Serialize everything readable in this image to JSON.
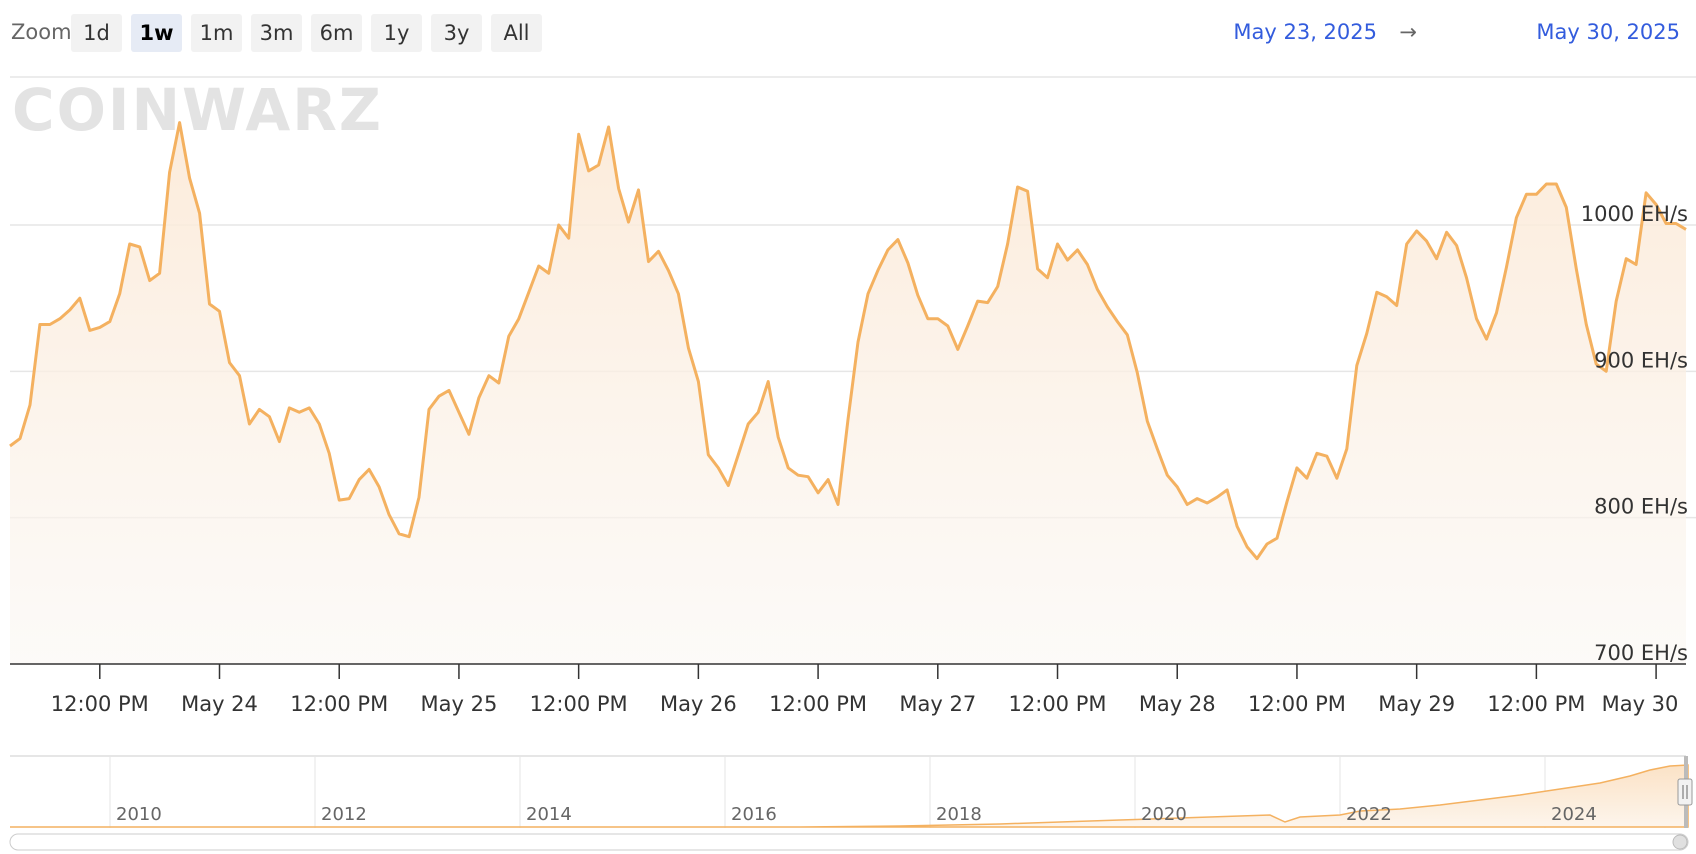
{
  "toolbar": {
    "zoom_label": "Zoom",
    "zoom_buttons": [
      {
        "label": "1d",
        "active": false
      },
      {
        "label": "1w",
        "active": true
      },
      {
        "label": "1m",
        "active": false
      },
      {
        "label": "3m",
        "active": false
      },
      {
        "label": "6m",
        "active": false
      },
      {
        "label": "1y",
        "active": false
      },
      {
        "label": "3y",
        "active": false
      },
      {
        "label": "All",
        "active": false
      }
    ],
    "range_start": "May 23, 2025",
    "range_arrow": "→",
    "range_end": "May 30, 2025"
  },
  "watermark": "COINWARZ",
  "colors": {
    "series_line": "#f4b160",
    "series_fill_top": "#fbe9d6",
    "grid": "#e6e6e6",
    "date_text": "#335cdd"
  },
  "chart_data": {
    "type": "area",
    "y_unit": "EH/s",
    "ylim": [
      700,
      1060
    ],
    "y_ticks": [
      {
        "value": 700,
        "label": "700 EH/s"
      },
      {
        "value": 800,
        "label": "800 EH/s"
      },
      {
        "value": 900,
        "label": "900 EH/s"
      },
      {
        "value": 1000,
        "label": "1000 EH/s"
      }
    ],
    "x_start": "2025-05-23 03:00",
    "x_end": "2025-05-30 04:00",
    "x_ticks": [
      {
        "at": "2025-05-23 12:00",
        "label": "12:00 PM"
      },
      {
        "at": "2025-05-24 00:00",
        "label": "May 24"
      },
      {
        "at": "2025-05-24 12:00",
        "label": "12:00 PM"
      },
      {
        "at": "2025-05-25 00:00",
        "label": "May 25"
      },
      {
        "at": "2025-05-25 12:00",
        "label": "12:00 PM"
      },
      {
        "at": "2025-05-26 00:00",
        "label": "May 26"
      },
      {
        "at": "2025-05-26 12:00",
        "label": "12:00 PM"
      },
      {
        "at": "2025-05-27 00:00",
        "label": "May 27"
      },
      {
        "at": "2025-05-27 12:00",
        "label": "12:00 PM"
      },
      {
        "at": "2025-05-28 00:00",
        "label": "May 28"
      },
      {
        "at": "2025-05-28 12:00",
        "label": "12:00 PM"
      },
      {
        "at": "2025-05-29 00:00",
        "label": "May 29"
      },
      {
        "at": "2025-05-29 12:00",
        "label": "12:00 PM"
      },
      {
        "at": "2025-05-30 00:00",
        "label": "May 30"
      }
    ],
    "series": [
      {
        "values": [
          [
            0,
            849
          ],
          [
            1,
            854
          ],
          [
            2,
            877
          ],
          [
            3,
            932
          ],
          [
            4,
            932
          ],
          [
            5,
            936
          ],
          [
            6,
            942
          ],
          [
            7,
            950
          ],
          [
            8,
            928
          ],
          [
            9,
            930
          ],
          [
            10,
            934
          ],
          [
            11,
            953
          ],
          [
            12,
            987
          ],
          [
            13,
            985
          ],
          [
            14,
            962
          ],
          [
            15,
            967
          ],
          [
            16,
            1036
          ],
          [
            17,
            1070
          ],
          [
            18,
            1032
          ],
          [
            19,
            1008
          ],
          [
            20,
            946
          ],
          [
            21,
            941
          ],
          [
            22,
            906
          ],
          [
            23,
            897
          ],
          [
            24,
            864
          ],
          [
            25,
            874
          ],
          [
            26,
            869
          ],
          [
            27,
            852
          ],
          [
            28,
            875
          ],
          [
            29,
            872
          ],
          [
            30,
            875
          ],
          [
            31,
            864
          ],
          [
            32,
            844
          ],
          [
            33,
            812
          ],
          [
            34,
            813
          ],
          [
            35,
            826
          ],
          [
            36,
            833
          ],
          [
            37,
            821
          ],
          [
            38,
            802
          ],
          [
            39,
            789
          ],
          [
            40,
            787
          ],
          [
            41,
            814
          ],
          [
            42,
            874
          ],
          [
            43,
            883
          ],
          [
            44,
            887
          ],
          [
            45,
            872
          ],
          [
            46,
            857
          ],
          [
            47,
            882
          ],
          [
            48,
            897
          ],
          [
            49,
            892
          ],
          [
            50,
            924
          ],
          [
            51,
            936
          ],
          [
            52,
            954
          ],
          [
            53,
            972
          ],
          [
            54,
            967
          ],
          [
            55,
            1000
          ],
          [
            56,
            991
          ],
          [
            57,
            1062
          ],
          [
            58,
            1037
          ],
          [
            59,
            1041
          ],
          [
            60,
            1067
          ],
          [
            61,
            1025
          ],
          [
            62,
            1002
          ],
          [
            63,
            1024
          ],
          [
            64,
            975
          ],
          [
            65,
            982
          ],
          [
            66,
            969
          ],
          [
            67,
            953
          ],
          [
            68,
            916
          ],
          [
            69,
            893
          ],
          [
            70,
            843
          ],
          [
            71,
            834
          ],
          [
            72,
            822
          ],
          [
            73,
            843
          ],
          [
            74,
            864
          ],
          [
            75,
            872
          ],
          [
            76,
            893
          ],
          [
            77,
            855
          ],
          [
            78,
            834
          ],
          [
            79,
            829
          ],
          [
            80,
            828
          ],
          [
            81,
            817
          ],
          [
            82,
            826
          ],
          [
            83,
            809
          ],
          [
            84,
            867
          ],
          [
            85,
            920
          ],
          [
            86,
            953
          ],
          [
            87,
            969
          ],
          [
            88,
            983
          ],
          [
            89,
            990
          ],
          [
            90,
            974
          ],
          [
            91,
            952
          ],
          [
            92,
            936
          ],
          [
            93,
            936
          ],
          [
            94,
            931
          ],
          [
            95,
            915
          ],
          [
            96,
            931
          ],
          [
            97,
            948
          ],
          [
            98,
            947
          ],
          [
            99,
            958
          ],
          [
            100,
            987
          ],
          [
            101,
            1026
          ],
          [
            102,
            1023
          ],
          [
            103,
            970
          ],
          [
            104,
            964
          ],
          [
            105,
            987
          ],
          [
            106,
            976
          ],
          [
            107,
            983
          ],
          [
            108,
            973
          ],
          [
            109,
            956
          ],
          [
            110,
            944
          ],
          [
            111,
            934
          ],
          [
            112,
            925
          ],
          [
            113,
            899
          ],
          [
            114,
            866
          ],
          [
            115,
            847
          ],
          [
            116,
            829
          ],
          [
            117,
            821
          ],
          [
            118,
            809
          ],
          [
            119,
            813
          ],
          [
            120,
            810
          ],
          [
            121,
            814
          ],
          [
            122,
            819
          ],
          [
            123,
            794
          ],
          [
            124,
            780
          ],
          [
            125,
            772
          ],
          [
            126,
            782
          ],
          [
            127,
            786
          ],
          [
            128,
            811
          ],
          [
            129,
            834
          ],
          [
            130,
            827
          ],
          [
            131,
            844
          ],
          [
            132,
            842
          ],
          [
            133,
            827
          ],
          [
            134,
            847
          ],
          [
            135,
            904
          ],
          [
            136,
            926
          ],
          [
            137,
            954
          ],
          [
            138,
            951
          ],
          [
            139,
            945
          ],
          [
            140,
            987
          ],
          [
            141,
            996
          ],
          [
            142,
            989
          ],
          [
            143,
            977
          ],
          [
            144,
            995
          ],
          [
            145,
            986
          ],
          [
            146,
            964
          ],
          [
            147,
            936
          ],
          [
            148,
            922
          ],
          [
            149,
            940
          ],
          [
            150,
            971
          ],
          [
            151,
            1005
          ],
          [
            152,
            1021
          ],
          [
            153,
            1021
          ],
          [
            154,
            1028
          ],
          [
            155,
            1028
          ],
          [
            156,
            1012
          ],
          [
            157,
            970
          ],
          [
            158,
            932
          ],
          [
            159,
            905
          ],
          [
            160,
            900
          ],
          [
            161,
            948
          ],
          [
            162,
            977
          ],
          [
            163,
            973
          ],
          [
            164,
            1022
          ],
          [
            165,
            1014
          ],
          [
            166,
            1001
          ],
          [
            167,
            1001
          ],
          [
            168,
            997
          ]
        ]
      }
    ],
    "navigator": {
      "x_labels": [
        "2010",
        "2012",
        "2014",
        "2016",
        "2018",
        "2020",
        "2022",
        "2024"
      ]
    }
  }
}
